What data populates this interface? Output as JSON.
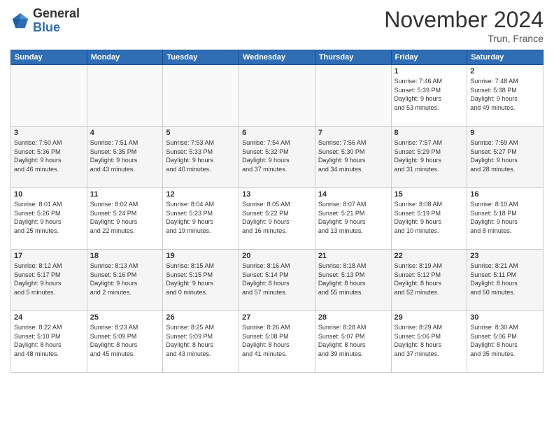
{
  "logo": {
    "general": "General",
    "blue": "Blue"
  },
  "title": "November 2024",
  "location": "Trun, France",
  "weekdays": [
    "Sunday",
    "Monday",
    "Tuesday",
    "Wednesday",
    "Thursday",
    "Friday",
    "Saturday"
  ],
  "weeks": [
    [
      {
        "day": "",
        "info": ""
      },
      {
        "day": "",
        "info": ""
      },
      {
        "day": "",
        "info": ""
      },
      {
        "day": "",
        "info": ""
      },
      {
        "day": "",
        "info": ""
      },
      {
        "day": "1",
        "info": "Sunrise: 7:46 AM\nSunset: 5:39 PM\nDaylight: 9 hours\nand 53 minutes."
      },
      {
        "day": "2",
        "info": "Sunrise: 7:48 AM\nSunset: 5:38 PM\nDaylight: 9 hours\nand 49 minutes."
      }
    ],
    [
      {
        "day": "3",
        "info": "Sunrise: 7:50 AM\nSunset: 5:36 PM\nDaylight: 9 hours\nand 46 minutes."
      },
      {
        "day": "4",
        "info": "Sunrise: 7:51 AM\nSunset: 5:35 PM\nDaylight: 9 hours\nand 43 minutes."
      },
      {
        "day": "5",
        "info": "Sunrise: 7:53 AM\nSunset: 5:33 PM\nDaylight: 9 hours\nand 40 minutes."
      },
      {
        "day": "6",
        "info": "Sunrise: 7:54 AM\nSunset: 5:32 PM\nDaylight: 9 hours\nand 37 minutes."
      },
      {
        "day": "7",
        "info": "Sunrise: 7:56 AM\nSunset: 5:30 PM\nDaylight: 9 hours\nand 34 minutes."
      },
      {
        "day": "8",
        "info": "Sunrise: 7:57 AM\nSunset: 5:29 PM\nDaylight: 9 hours\nand 31 minutes."
      },
      {
        "day": "9",
        "info": "Sunrise: 7:59 AM\nSunset: 5:27 PM\nDaylight: 9 hours\nand 28 minutes."
      }
    ],
    [
      {
        "day": "10",
        "info": "Sunrise: 8:01 AM\nSunset: 5:26 PM\nDaylight: 9 hours\nand 25 minutes."
      },
      {
        "day": "11",
        "info": "Sunrise: 8:02 AM\nSunset: 5:24 PM\nDaylight: 9 hours\nand 22 minutes."
      },
      {
        "day": "12",
        "info": "Sunrise: 8:04 AM\nSunset: 5:23 PM\nDaylight: 9 hours\nand 19 minutes."
      },
      {
        "day": "13",
        "info": "Sunrise: 8:05 AM\nSunset: 5:22 PM\nDaylight: 9 hours\nand 16 minutes."
      },
      {
        "day": "14",
        "info": "Sunrise: 8:07 AM\nSunset: 5:21 PM\nDaylight: 9 hours\nand 13 minutes."
      },
      {
        "day": "15",
        "info": "Sunrise: 8:08 AM\nSunset: 5:19 PM\nDaylight: 9 hours\nand 10 minutes."
      },
      {
        "day": "16",
        "info": "Sunrise: 8:10 AM\nSunset: 5:18 PM\nDaylight: 9 hours\nand 8 minutes."
      }
    ],
    [
      {
        "day": "17",
        "info": "Sunrise: 8:12 AM\nSunset: 5:17 PM\nDaylight: 9 hours\nand 5 minutes."
      },
      {
        "day": "18",
        "info": "Sunrise: 8:13 AM\nSunset: 5:16 PM\nDaylight: 9 hours\nand 2 minutes."
      },
      {
        "day": "19",
        "info": "Sunrise: 8:15 AM\nSunset: 5:15 PM\nDaylight: 9 hours\nand 0 minutes."
      },
      {
        "day": "20",
        "info": "Sunrise: 8:16 AM\nSunset: 5:14 PM\nDaylight: 8 hours\nand 57 minutes."
      },
      {
        "day": "21",
        "info": "Sunrise: 8:18 AM\nSunset: 5:13 PM\nDaylight: 8 hours\nand 55 minutes."
      },
      {
        "day": "22",
        "info": "Sunrise: 8:19 AM\nSunset: 5:12 PM\nDaylight: 8 hours\nand 52 minutes."
      },
      {
        "day": "23",
        "info": "Sunrise: 8:21 AM\nSunset: 5:11 PM\nDaylight: 8 hours\nand 50 minutes."
      }
    ],
    [
      {
        "day": "24",
        "info": "Sunrise: 8:22 AM\nSunset: 5:10 PM\nDaylight: 8 hours\nand 48 minutes."
      },
      {
        "day": "25",
        "info": "Sunrise: 8:23 AM\nSunset: 5:09 PM\nDaylight: 8 hours\nand 45 minutes."
      },
      {
        "day": "26",
        "info": "Sunrise: 8:25 AM\nSunset: 5:09 PM\nDaylight: 8 hours\nand 43 minutes."
      },
      {
        "day": "27",
        "info": "Sunrise: 8:26 AM\nSunset: 5:08 PM\nDaylight: 8 hours\nand 41 minutes."
      },
      {
        "day": "28",
        "info": "Sunrise: 8:28 AM\nSunset: 5:07 PM\nDaylight: 8 hours\nand 39 minutes."
      },
      {
        "day": "29",
        "info": "Sunrise: 8:29 AM\nSunset: 5:06 PM\nDaylight: 8 hours\nand 37 minutes."
      },
      {
        "day": "30",
        "info": "Sunrise: 8:30 AM\nSunset: 5:06 PM\nDaylight: 8 hours\nand 35 minutes."
      }
    ]
  ]
}
